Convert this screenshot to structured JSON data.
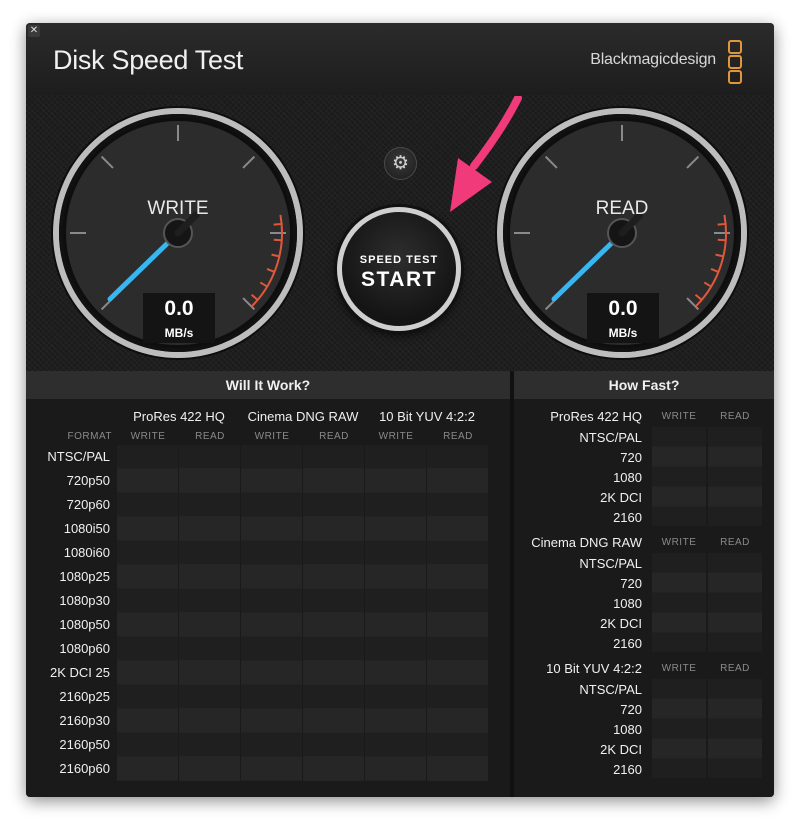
{
  "window": {
    "close_icon": "✕",
    "title": "Disk Speed Test",
    "brand": "Blackmagicdesign",
    "brand_logo_color": "#e0963a"
  },
  "gauges": {
    "write": {
      "label": "WRITE",
      "value": "0.0",
      "unit": "MB/s"
    },
    "read": {
      "label": "READ",
      "value": "0.0",
      "unit": "MB/s"
    },
    "needle_color": "#38b6f0",
    "redline_color": "#e0583c"
  },
  "controls": {
    "settings_icon": "gear-icon",
    "start_small": "SPEED TEST",
    "start_big": "START",
    "annotation_arrow_color": "#f03a7a"
  },
  "will_it_work": {
    "title": "Will It Work?",
    "format_header": "FORMAT",
    "codecs": [
      "ProRes 422 HQ",
      "Cinema DNG RAW",
      "10 Bit YUV 4:2:2"
    ],
    "write_label": "WRITE",
    "read_label": "READ",
    "formats": [
      "NTSC/PAL",
      "720p50",
      "720p60",
      "1080i50",
      "1080i60",
      "1080p25",
      "1080p30",
      "1080p50",
      "1080p60",
      "2K DCI 25",
      "2160p25",
      "2160p30",
      "2160p50",
      "2160p60"
    ]
  },
  "how_fast": {
    "title": "How Fast?",
    "write_label": "WRITE",
    "read_label": "READ",
    "groups": [
      {
        "codec": "ProRes 422 HQ",
        "rows": [
          "NTSC/PAL",
          "720",
          "1080",
          "2K DCI",
          "2160"
        ]
      },
      {
        "codec": "Cinema DNG RAW",
        "rows": [
          "NTSC/PAL",
          "720",
          "1080",
          "2K DCI",
          "2160"
        ]
      },
      {
        "codec": "10 Bit YUV 4:2:2",
        "rows": [
          "NTSC/PAL",
          "720",
          "1080",
          "2K DCI",
          "2160"
        ]
      }
    ]
  }
}
